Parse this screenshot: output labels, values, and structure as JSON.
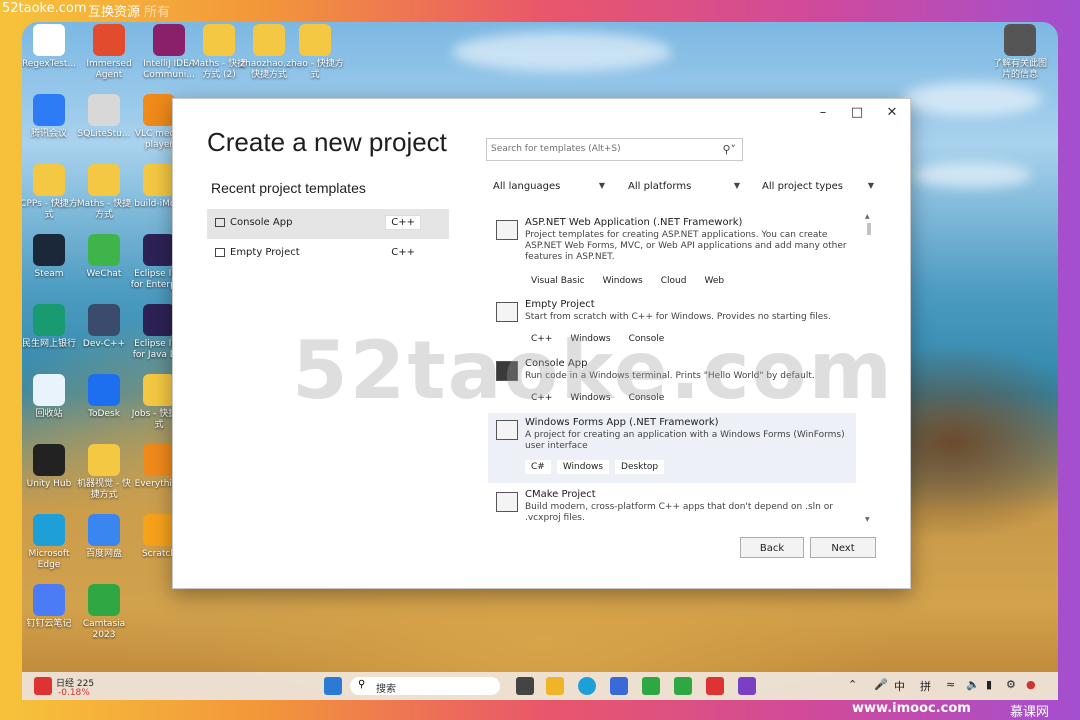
{
  "top_overlay": {
    "site_text": "52taoke.com",
    "group_text": "互换资源",
    "extra_text": "所有"
  },
  "bottom_overlay": {
    "site": "www.imooc.com",
    "brand": "慕课网"
  },
  "desktop_icons": [
    {
      "label": "RegexTest...",
      "color": "#ffffff"
    },
    {
      "label": "Immersed Agent",
      "color": "#e34b2f"
    },
    {
      "label": "IntelliJ IDEA Communi...",
      "color": "#8a1f6a"
    },
    {
      "label": "Maths - 快捷方式 (2)",
      "color": "#f4c842"
    },
    {
      "label": "zhaozhao... - 快捷方式",
      "color": "#f4c842"
    },
    {
      "label": "zhao - 快捷方式",
      "color": "#f4c842"
    },
    {
      "label": "腾讯会议",
      "color": "#2d7cf6"
    },
    {
      "label": "SQLiteStu...",
      "color": "#d8d8d8"
    },
    {
      "label": "VLC media player",
      "color": "#f08a1a"
    },
    {
      "label": "CPPs - 快捷方式",
      "color": "#f4c842"
    },
    {
      "label": "Maths - 快捷方式",
      "color": "#f4c842"
    },
    {
      "label": "build-iMo...",
      "color": "#f4c842"
    },
    {
      "label": "Steam",
      "color": "#1b2838"
    },
    {
      "label": "WeChat",
      "color": "#3fb44a"
    },
    {
      "label": "Eclipse IDE for Enterpr...",
      "color": "#2c2255"
    },
    {
      "label": "民生网上银行",
      "color": "#1a9a70"
    },
    {
      "label": "Dev-C++",
      "color": "#3a4b6b"
    },
    {
      "label": "Eclipse IDE for Java D...",
      "color": "#2c2255"
    },
    {
      "label": "回收站",
      "color": "#e8f3fb"
    },
    {
      "label": "ToDesk",
      "color": "#1e6ff0"
    },
    {
      "label": "Jobs - 快捷方式",
      "color": "#f4c842"
    },
    {
      "label": "Unity Hub",
      "color": "#222222"
    },
    {
      "label": "机器视觉 - 快捷方式",
      "color": "#f4c842"
    },
    {
      "label": "Everything",
      "color": "#f08a1a"
    },
    {
      "label": "Microsoft Edge",
      "color": "#1f9fd8"
    },
    {
      "label": "百度网盘",
      "color": "#3a86f0"
    },
    {
      "label": "Scratch",
      "color": "#f7a21b"
    },
    {
      "label": "钉钉云笔记",
      "color": "#4c7cf5"
    },
    {
      "label": "Camtasia 2023",
      "color": "#2fa742"
    },
    {
      "label": "了解有关此图片的信息",
      "color": "#555555"
    }
  ],
  "dialog": {
    "title": "Create a new project",
    "search_placeholder": "Search for templates (Alt+S)",
    "recent_header": "Recent project templates",
    "recent": [
      {
        "name": "Console App",
        "lang": "C++"
      },
      {
        "name": "Empty Project",
        "lang": "C++"
      }
    ],
    "filters": {
      "language": "All languages",
      "platform": "All platforms",
      "project_type": "All project types"
    },
    "templates": [
      {
        "name": "ASP.NET Web Application (.NET Framework)",
        "desc": "Project templates for creating ASP.NET applications. You can create ASP.NET Web Forms, MVC, or Web API applications and add many other features in ASP.NET.",
        "tags": [
          "Visual Basic",
          "Windows",
          "Cloud",
          "Web"
        ]
      },
      {
        "name": "Empty Project",
        "desc": "Start from scratch with C++ for Windows. Provides no starting files.",
        "tags": [
          "C++",
          "Windows",
          "Console"
        ]
      },
      {
        "name": "Console App",
        "desc": "Run code in a Windows terminal. Prints \"Hello World\" by default.",
        "tags": [
          "C++",
          "Windows",
          "Console"
        ]
      },
      {
        "name": "Windows Forms App (.NET Framework)",
        "desc": "A project for creating an application with a Windows Forms (WinForms) user interface",
        "tags": [
          "C#",
          "Windows",
          "Desktop"
        ]
      },
      {
        "name": "CMake Project",
        "desc": "Build modern, cross-platform C++ apps that don't depend on .sln or .vcxproj files.",
        "tags": []
      }
    ],
    "back_label": "Back",
    "next_label": "Next"
  },
  "watermark": "52taoke.com",
  "taskbar": {
    "stock_name": "日经 225",
    "stock_change": "-0.18%",
    "search_placeholder": "搜索",
    "ime_lang": "中",
    "ime_mode": "拼"
  }
}
